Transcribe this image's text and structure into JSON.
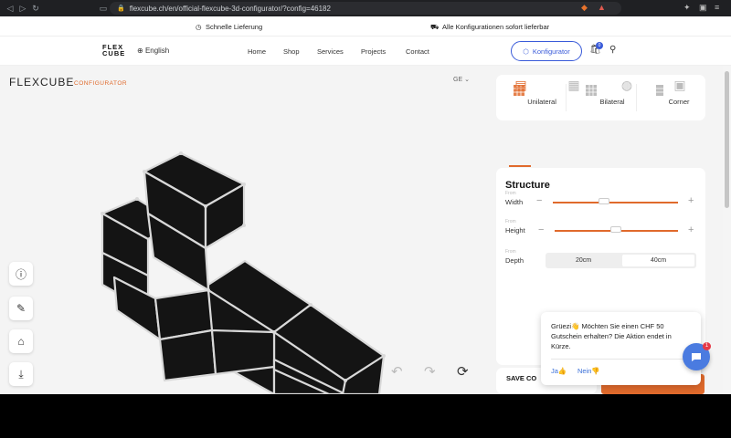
{
  "browser": {
    "url": "flexcube.ch/en/official-flexcube-3d-configurator/?config=46182",
    "back": "◁",
    "forward": "▷",
    "reload": "↻",
    "bookmark_icon": "bookmark-icon"
  },
  "promo": {
    "left_text": "Schnelle Lieferung",
    "right_text": "Alle Konfigurationen sofort lieferbar"
  },
  "header": {
    "logo_line1": "FLEX",
    "logo_line2": "CUBE",
    "language": "English",
    "nav": [
      "Home",
      "Shop",
      "Services",
      "Projects",
      "Contact"
    ],
    "konfigurator_label": "Konfigurator",
    "cart_count": "0"
  },
  "configurator": {
    "title": "FLEXCUBE",
    "subtitle": "CONFIGURATOR",
    "unit_select": "GE"
  },
  "panel": {
    "types": [
      {
        "label": "Unilateral",
        "active": true
      },
      {
        "label": "Bilateral",
        "active": false
      },
      {
        "label": "Corner",
        "active": false
      }
    ],
    "section_title": "Structure",
    "width": {
      "tiny": "From",
      "label": "Width",
      "value_fraction": 0.45
    },
    "height": {
      "tiny": "From",
      "label": "Height",
      "value_fraction": 0.5
    },
    "depth": {
      "tiny": "From",
      "label": "Depth",
      "options": [
        "20cm",
        "40cm"
      ],
      "selected": "40cm"
    },
    "save_label": "SAVE CO"
  },
  "chat": {
    "message": "Grüezi👋 Möchten Sie einen CHF 50 Gutschein erhalten? Die Aktion endet in Kürze.",
    "yes": "Ja👍",
    "no": "Nein👎",
    "badge": "1"
  },
  "colors": {
    "accent": "#e06a2c",
    "primary": "#3a5bd9",
    "shelf_black": "#141414",
    "frame": "#d9d9d9"
  }
}
